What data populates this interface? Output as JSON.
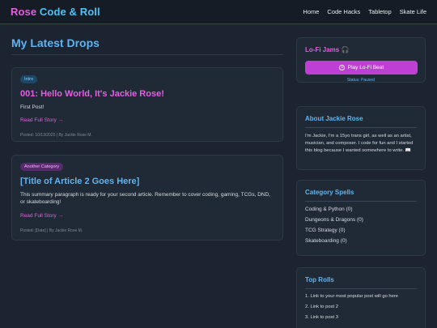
{
  "header": {
    "brand_part1": "Rose",
    "brand_part2": "Code & Roll",
    "nav": [
      "Home",
      "Code Hacks",
      "Tabletop",
      "Skate Life"
    ]
  },
  "main": {
    "title": "My Latest Drops",
    "posts": [
      {
        "tag": "Intro",
        "title": "001: Hello World, It's Jackie Rose!",
        "summary": "First Post!",
        "read_more": "Read Full Story →",
        "meta": "Posted: 10/13/2025 | By Jackie Rose M."
      },
      {
        "tag": "Another Category",
        "title": "[Title of Article 2 Goes Here]",
        "summary": "This summary paragraph is ready for your second article. Remember to cover coding, gaming, TCGs, DND, or skateboarding!",
        "read_more": "Read Full Story →",
        "meta": "Posted: [Date] | By Jackie Rose M."
      }
    ]
  },
  "sidebar": {
    "lofi": {
      "title": "Lo-Fi Jams 🎧",
      "button": "Play Lo-Fi Beat",
      "status": "Status: Paused"
    },
    "about": {
      "title": "About Jackie Rose",
      "text": "I'm Jackie, I'm a 15yo trans girl, as well as an artist, musician, and composer. I code for fun and I started this blog because I wanted somewhere to write. 📖"
    },
    "categories": {
      "title": "Category Spells",
      "items": [
        "Coding & Python (0)",
        "Dungeons & Dragons (0)",
        "TCG Strategy (0)",
        "Skateboarding (0)"
      ]
    },
    "rolls": {
      "title": "Top Rolls",
      "items": [
        "1. Link to your most popular post will go here",
        "2. Link to post 2",
        "3. Link to post 3"
      ]
    }
  },
  "colors": {
    "background": "#1b2430",
    "accent_pink": "#e25fe0",
    "accent_blue": "#5fb4f0",
    "button": "#bd3fd3"
  }
}
